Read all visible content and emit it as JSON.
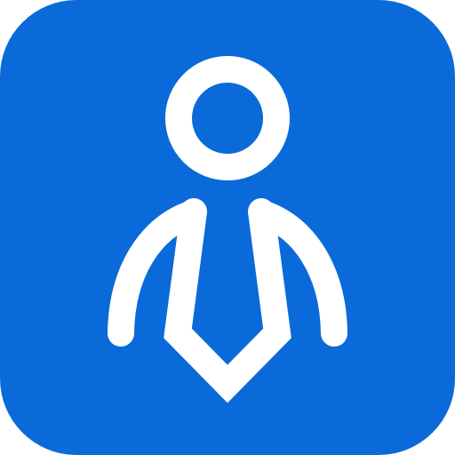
{
  "app_icon": {
    "icon_name": "business-person-icon",
    "background_color": "#0A6AD9",
    "foreground_color": "#FFFFFF"
  }
}
